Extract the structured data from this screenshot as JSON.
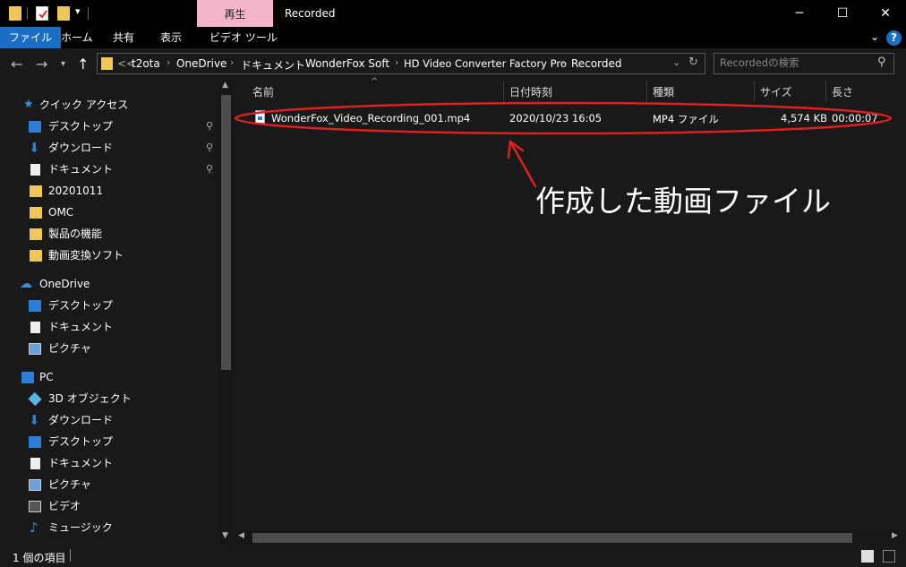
{
  "window": {
    "context_tab_head": "再生",
    "title": "Recorded",
    "minimize": "─",
    "maximize": "☐",
    "close": "✕"
  },
  "ribbon": {
    "tabs": [
      "ファイル",
      "ホーム",
      "共有",
      "表示",
      "ビデオ ツール"
    ]
  },
  "address": {
    "crumbs": [
      "t2ota",
      "OneDrive",
      "ドキュメント",
      "WonderFox Soft",
      "HD Video Converter Factory Pro",
      "Recorded"
    ],
    "overflow": "<<"
  },
  "search": {
    "placeholder": "Recordedの検索"
  },
  "sidebar": {
    "quick_access": "クイック アクセス",
    "quick_items": [
      "デスクトップ",
      "ダウンロード",
      "ドキュメント",
      "20201011",
      "OMC",
      "製品の機能",
      "動画変換ソフト"
    ],
    "onedrive": "OneDrive",
    "onedrive_items": [
      "デスクトップ",
      "ドキュメント",
      "ピクチャ"
    ],
    "pc": "PC",
    "pc_items": [
      "3D オブジェクト",
      "ダウンロード",
      "デスクトップ",
      "ドキュメント",
      "ピクチャ",
      "ビデオ",
      "ミュージック"
    ]
  },
  "columns": {
    "name": "名前",
    "date": "日付時刻",
    "type": "種類",
    "size": "サイズ",
    "length": "長さ"
  },
  "file": {
    "name": "WonderFox_Video_Recording_001.mp4",
    "date": "2020/10/23 16:05",
    "type": "MP4 ファイル",
    "size": "4,574 KB",
    "length": "00:00:07"
  },
  "annotation": {
    "text": "作成した動画ファイル",
    "color": "#e02020"
  },
  "status": {
    "count": "1 個の項目"
  },
  "colors": {
    "accent": "#1a6fc4",
    "context_tab": "#f5b5c8",
    "folder": "#f0c85a"
  }
}
